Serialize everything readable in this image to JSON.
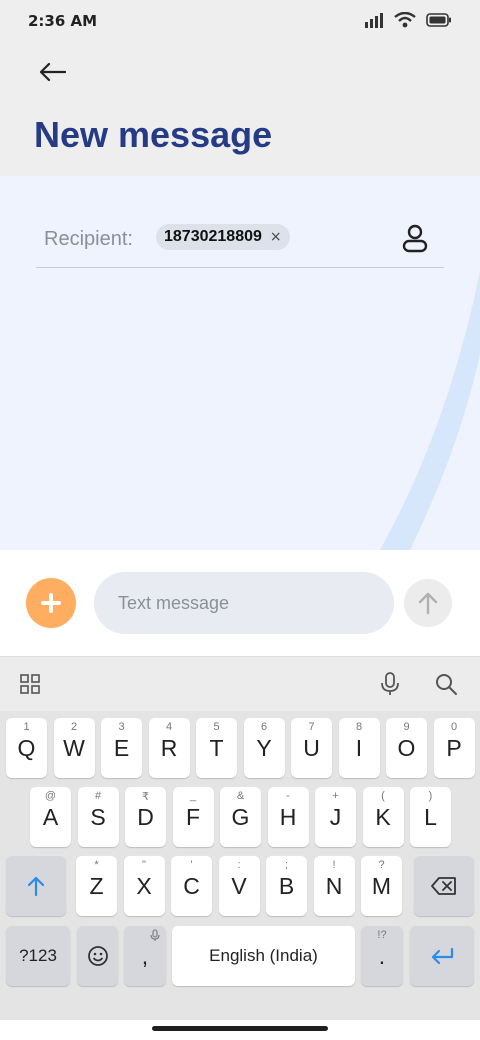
{
  "status_bar": {
    "time": "2:36 AM",
    "icons": [
      "signal-icon",
      "wifi-icon",
      "battery-icon"
    ]
  },
  "header": {
    "title": "New message",
    "back_icon": "arrow-left-icon"
  },
  "recipient": {
    "label": "Recipient:",
    "chip_number": "18730218809",
    "chip_remove": "×",
    "contact_icon": "person-icon"
  },
  "composer": {
    "add_icon": "plus-icon",
    "placeholder": "Text message",
    "send_icon": "arrow-up-icon"
  },
  "keyboard_toolbar": {
    "left_icon": "grid-icon",
    "mic_icon": "mic-icon",
    "search_icon": "search-icon"
  },
  "keyboard": {
    "row1": [
      {
        "label": "Q",
        "hint": "1"
      },
      {
        "label": "W",
        "hint": "2"
      },
      {
        "label": "E",
        "hint": "3"
      },
      {
        "label": "R",
        "hint": "4"
      },
      {
        "label": "T",
        "hint": "5"
      },
      {
        "label": "Y",
        "hint": "6"
      },
      {
        "label": "U",
        "hint": "7"
      },
      {
        "label": "I",
        "hint": "8"
      },
      {
        "label": "O",
        "hint": "9"
      },
      {
        "label": "P",
        "hint": "0"
      }
    ],
    "row2": [
      {
        "label": "A",
        "hint": "@"
      },
      {
        "label": "S",
        "hint": "#"
      },
      {
        "label": "D",
        "hint": "₹"
      },
      {
        "label": "F",
        "hint": "_"
      },
      {
        "label": "G",
        "hint": "&"
      },
      {
        "label": "H",
        "hint": "-"
      },
      {
        "label": "J",
        "hint": "+"
      },
      {
        "label": "K",
        "hint": "("
      },
      {
        "label": "L",
        "hint": ")"
      }
    ],
    "row3": [
      {
        "label": "Z",
        "hint": "*"
      },
      {
        "label": "X",
        "hint": "\""
      },
      {
        "label": "C",
        "hint": "'"
      },
      {
        "label": "V",
        "hint": ":"
      },
      {
        "label": "B",
        "hint": ";"
      },
      {
        "label": "N",
        "hint": "!"
      },
      {
        "label": "M",
        "hint": "?"
      }
    ],
    "symbols_label": "?123",
    "emoji_icon": "smiley-icon",
    "comma_label": ",",
    "space_label": "English (India)",
    "period_label": ".",
    "period_hint": "!?",
    "shift_icon": "shift-arrow-icon",
    "backspace_icon": "backspace-icon",
    "enter_icon": "enter-icon"
  },
  "colors": {
    "title": "#253b85",
    "accent_orange": "#ffad61",
    "keyboard_blue": "#2b8ee6",
    "compose_bg": "#eef3fd"
  }
}
